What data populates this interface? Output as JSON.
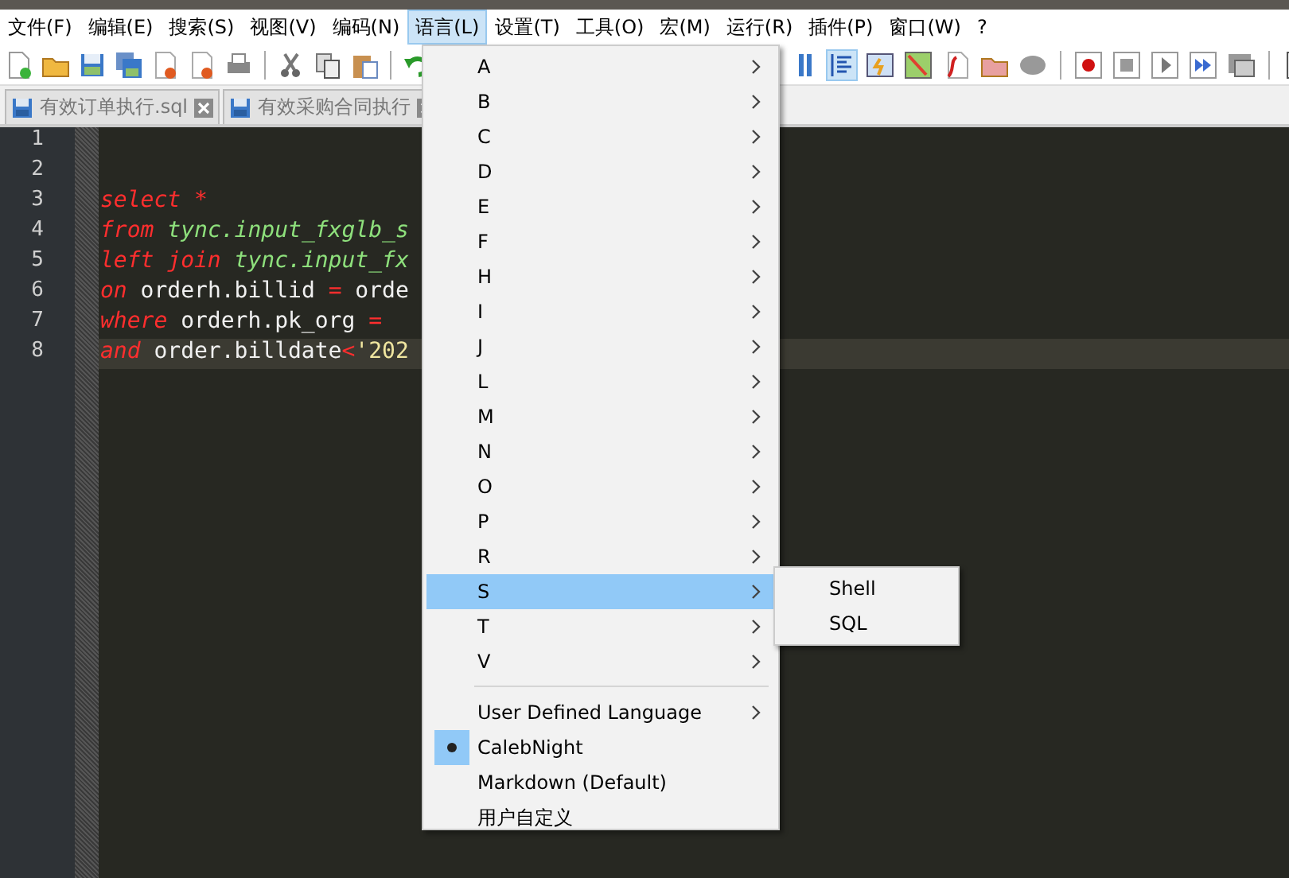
{
  "menu_bar": [
    {
      "label": "文件(F)",
      "selected": false
    },
    {
      "label": "编辑(E)",
      "selected": false
    },
    {
      "label": "搜索(S)",
      "selected": false
    },
    {
      "label": "视图(V)",
      "selected": false
    },
    {
      "label": "编码(N)",
      "selected": false
    },
    {
      "label": "语言(L)",
      "selected": true
    },
    {
      "label": "设置(T)",
      "selected": false
    },
    {
      "label": "工具(O)",
      "selected": false
    },
    {
      "label": "宏(M)",
      "selected": false
    },
    {
      "label": "运行(R)",
      "selected": false
    },
    {
      "label": "插件(P)",
      "selected": false
    },
    {
      "label": "窗口(W)",
      "selected": false
    },
    {
      "label": "?",
      "selected": false
    }
  ],
  "tabs": [
    {
      "label": "有效订单执行.sql"
    },
    {
      "label": "有效采购合同执行"
    }
  ],
  "editor": {
    "lines": [
      {
        "number": "1",
        "current": false
      },
      {
        "number": "2",
        "current": false
      },
      {
        "number": "3",
        "current": false,
        "tokens": [
          {
            "kind": "keyword",
            "text": "select "
          },
          {
            "kind": "operator",
            "text": "*"
          }
        ]
      },
      {
        "number": "4",
        "current": false,
        "tokens": [
          {
            "kind": "keyword",
            "text": "from "
          },
          {
            "kind": "table",
            "text": "tync.input_fxglb_s"
          }
        ]
      },
      {
        "number": "5",
        "current": false,
        "tokens": [
          {
            "kind": "keyword",
            "text": "left join "
          },
          {
            "kind": "table",
            "text": "tync.input_fx"
          }
        ]
      },
      {
        "number": "6",
        "current": false,
        "tokens": [
          {
            "kind": "keyword",
            "text": "on "
          },
          {
            "kind": "plain",
            "text": "orderh.billid "
          },
          {
            "kind": "operator",
            "text": "="
          },
          {
            "kind": "plain",
            "text": " orde"
          }
        ]
      },
      {
        "number": "7",
        "current": false,
        "tokens": [
          {
            "kind": "keyword",
            "text": "where "
          },
          {
            "kind": "plain",
            "text": "orderh.pk_org "
          },
          {
            "kind": "operator",
            "text": "="
          }
        ]
      },
      {
        "number": "8",
        "current": true,
        "tokens": [
          {
            "kind": "keyword",
            "text": "and "
          },
          {
            "kind": "plain",
            "text": "order.billdate"
          },
          {
            "kind": "operator",
            "text": "<"
          },
          {
            "kind": "string",
            "text": "'202"
          }
        ]
      }
    ]
  },
  "language_menu": {
    "items": [
      {
        "label": "A",
        "submenu": true,
        "selected": false,
        "checked": false
      },
      {
        "label": "B",
        "submenu": true,
        "selected": false,
        "checked": false
      },
      {
        "label": "C",
        "submenu": true,
        "selected": false,
        "checked": false
      },
      {
        "label": "D",
        "submenu": true,
        "selected": false,
        "checked": false
      },
      {
        "label": "E",
        "submenu": true,
        "selected": false,
        "checked": false
      },
      {
        "label": "F",
        "submenu": true,
        "selected": false,
        "checked": false
      },
      {
        "label": "H",
        "submenu": true,
        "selected": false,
        "checked": false
      },
      {
        "label": "I",
        "submenu": true,
        "selected": false,
        "checked": false
      },
      {
        "label": "J",
        "submenu": true,
        "selected": false,
        "checked": false
      },
      {
        "label": "L",
        "submenu": true,
        "selected": false,
        "checked": false
      },
      {
        "label": "M",
        "submenu": true,
        "selected": false,
        "checked": false
      },
      {
        "label": "N",
        "submenu": true,
        "selected": false,
        "checked": false
      },
      {
        "label": "O",
        "submenu": true,
        "selected": false,
        "checked": false
      },
      {
        "label": "P",
        "submenu": true,
        "selected": false,
        "checked": false
      },
      {
        "label": "R",
        "submenu": true,
        "selected": false,
        "checked": false
      },
      {
        "label": "S",
        "submenu": true,
        "selected": true,
        "checked": false
      },
      {
        "label": "T",
        "submenu": true,
        "selected": false,
        "checked": false
      },
      {
        "label": "V",
        "submenu": true,
        "selected": false,
        "checked": false
      },
      {
        "kind": "separator"
      },
      {
        "label": "User Defined Language",
        "submenu": true,
        "selected": false,
        "checked": false
      },
      {
        "label": "CalebNight",
        "submenu": false,
        "selected": false,
        "checked": true
      },
      {
        "label": "Markdown (Default)",
        "submenu": false,
        "selected": false,
        "checked": false
      },
      {
        "label": "用户自定义",
        "submenu": false,
        "selected": false,
        "checked": false
      }
    ],
    "submenu": [
      {
        "label": "Shell"
      },
      {
        "label": "SQL"
      }
    ]
  }
}
